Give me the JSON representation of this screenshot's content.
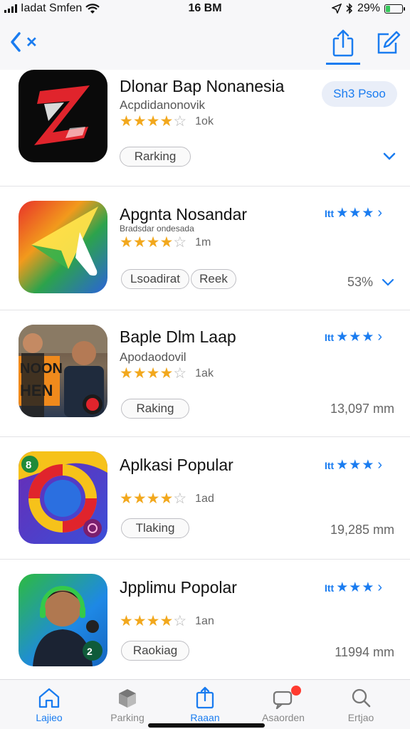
{
  "status_bar": {
    "carrier": "Iadat Smfen",
    "time": "16 BM",
    "battery_text": "29%",
    "battery_level": 0.29,
    "battery_color": "#34c759"
  },
  "nav": {
    "back_label": "✕",
    "back_icon": "chevron-left-icon",
    "share_icon": "share-icon",
    "compose_icon": "compose-icon",
    "accent_color": "#1a7cf0"
  },
  "apps": [
    {
      "name": "Dlonar Bap Nonanesia",
      "subtitle": "Acpdidanonovik",
      "stars": 4,
      "rating_count": "1ok",
      "tag": "Rarking",
      "action": "Sh3 Psoo",
      "icon": "lightning-z-icon"
    },
    {
      "name": "Apgnta Nosandar",
      "subtitle": "Bradsdar ondesada",
      "stars": 4,
      "rating_count": "1m",
      "tags": [
        "Lsoadirat",
        "Reek"
      ],
      "percent": "53%",
      "rating_prefix": "Itt",
      "icon": "arrow-logo-icon"
    },
    {
      "name": "Baple Dlm Laap",
      "subtitle": "Apodaodovil",
      "stars": 4,
      "rating_count": "1ak",
      "tag": "Raking",
      "downloads": "13,097 mm",
      "rating_prefix": "Itt",
      "icon": "people-photo-icon"
    },
    {
      "name": "Aplkasi Popular",
      "subtitle": "",
      "stars": 4,
      "rating_count": "1ad",
      "tag": "Tlaking",
      "downloads": "19,285 mm",
      "rating_prefix": "Itt",
      "icon": "ring-logo-icon"
    },
    {
      "name": "Jpplimu Popolar",
      "subtitle": "",
      "stars": 4,
      "rating_count": "1an",
      "tag": "Raokiag",
      "downloads": "11994 mm",
      "rating_prefix": "Itt",
      "icon": "person-headset-icon"
    }
  ],
  "tabs": [
    {
      "label": "Lajieo",
      "icon": "home-icon",
      "active": true
    },
    {
      "label": "Parking",
      "icon": "box-icon",
      "active": false
    },
    {
      "label": "Raaan",
      "icon": "upload-icon",
      "active": true
    },
    {
      "label": "Asaorden",
      "icon": "chat-icon",
      "active": false
    },
    {
      "label": "Ertjao",
      "icon": "search-icon",
      "active": false
    }
  ]
}
